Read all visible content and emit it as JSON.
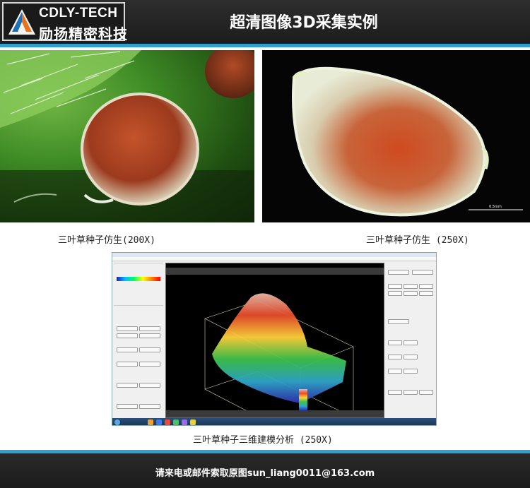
{
  "header": {
    "logo_en": "CDLY-TECH",
    "logo_cn": "励扬精密科技",
    "title": "超清图像3D采集实例",
    "colors": {
      "bar": "#262626",
      "stripe": "#2d9fd3",
      "logo_orange": "#e8731c",
      "logo_blue": "#1e6fb5"
    }
  },
  "photos": {
    "left": {
      "caption": "三叶草种子仿生(200X)"
    },
    "right": {
      "caption": "三叶草种子仿生 (250X)",
      "scale_bar": "0.5mm"
    }
  },
  "software": {
    "caption": "三叶草种子三维建模分析 (250X)"
  },
  "footer": {
    "contact": "请来电或邮件索取原图sun_liang0011@163.com"
  }
}
